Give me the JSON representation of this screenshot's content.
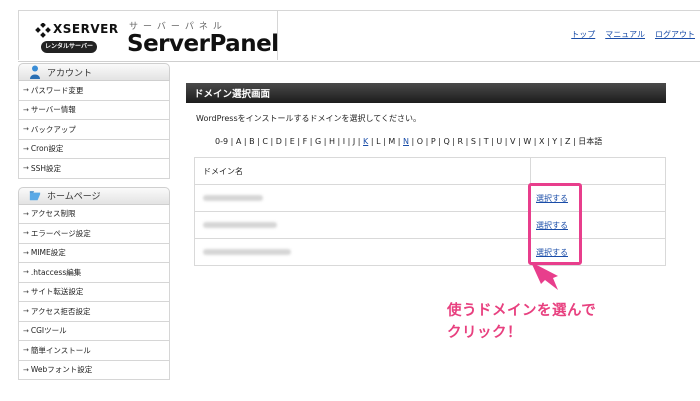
{
  "header": {
    "brand": "XSERVER",
    "brand_sub": "レンタルサーバー",
    "kana": "サーバーパネル",
    "title": "ServerPanel",
    "links": [
      "トップ",
      "マニュアル",
      "ログアウト"
    ]
  },
  "sidebar": {
    "sections": [
      {
        "title": "アカウント",
        "icon": "person-icon",
        "items": [
          "パスワード変更",
          "サーバー情報",
          "バックアップ",
          "Cron設定",
          "SSH設定"
        ]
      },
      {
        "title": "ホームページ",
        "icon": "folder-icon",
        "items": [
          "アクセス制限",
          "エラーページ設定",
          "MIME設定",
          ".htaccess編集",
          "サイト転送設定",
          "アクセス拒否設定",
          "CGIツール",
          "簡単インストール",
          "Webフォント設定"
        ]
      }
    ]
  },
  "main": {
    "title": "ドメイン選択画面",
    "description": "WordPressをインストールするドメインを選択してください。",
    "index": [
      "0-9",
      "A",
      "B",
      "C",
      "D",
      "E",
      "F",
      "G",
      "H",
      "I",
      "J",
      "K",
      "L",
      "M",
      "N",
      "O",
      "P",
      "Q",
      "R",
      "S",
      "T",
      "U",
      "V",
      "W",
      "X",
      "Y",
      "Z",
      "日本語"
    ],
    "linked_index": [
      "K",
      "N"
    ],
    "table": {
      "header": "ドメイン名",
      "rows": [
        {
          "action": "選択する"
        },
        {
          "action": "選択する"
        },
        {
          "action": "選択する"
        }
      ]
    }
  },
  "annotation": {
    "line1": "使うドメインを選んで",
    "line2": "クリック！",
    "color": "#e8407f"
  },
  "colors": {
    "link": "#1a4da8",
    "highlight": "#e83e8c",
    "titlebar": "#1c1c1c"
  }
}
